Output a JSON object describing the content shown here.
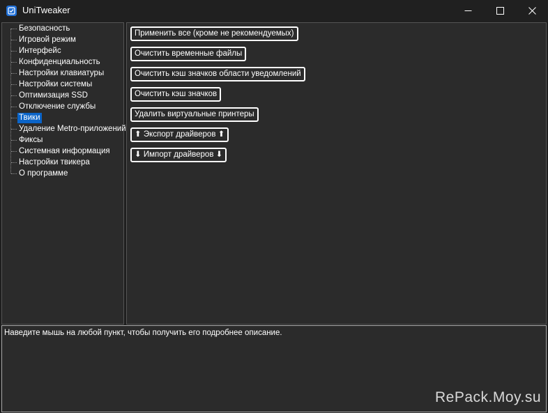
{
  "window": {
    "title": "UniTweaker"
  },
  "sidebar": {
    "items": [
      {
        "label": "Безопасность"
      },
      {
        "label": "Игровой режим"
      },
      {
        "label": "Интерфейс"
      },
      {
        "label": "Конфиденциальность"
      },
      {
        "label": "Настройки клавиатуры"
      },
      {
        "label": "Настройки системы"
      },
      {
        "label": "Оптимизация SSD"
      },
      {
        "label": "Отключение службы"
      },
      {
        "label": "Твики"
      },
      {
        "label": "Удаление Metro-приложений"
      },
      {
        "label": "Фиксы"
      },
      {
        "label": "Системная информация"
      },
      {
        "label": "Настройки твикера"
      },
      {
        "label": "О программе"
      }
    ],
    "selected_label": "Твики"
  },
  "actions": {
    "apply_all": "Применить все (кроме не рекомендуемых)",
    "clear_temp": "Очистить временные файлы",
    "clear_tray_icon_cache": "Очистить кэш значков области уведомлений",
    "clear_icon_cache": "Очистить кэш значков",
    "remove_virtual_printers": "Удалить виртуальные принтеры",
    "export_drivers": "⬆ Экспорт драйверов ⬆",
    "import_drivers": "⬇ Импорт драйверов ⬇"
  },
  "description": {
    "text": "Наведите мышь на любой пункт, чтобы получить его подробнее описание."
  },
  "watermark": {
    "text": "RePack.Moy.su"
  },
  "colors": {
    "background": "#1f1f1f",
    "panel": "#2b2b2b",
    "selection": "#0a64c8",
    "app_icon": "#1f6fd6"
  },
  "icons": {
    "app": "checkbox-icon",
    "minimize": "minimize-icon",
    "maximize": "maximize-icon",
    "close": "close-icon"
  }
}
